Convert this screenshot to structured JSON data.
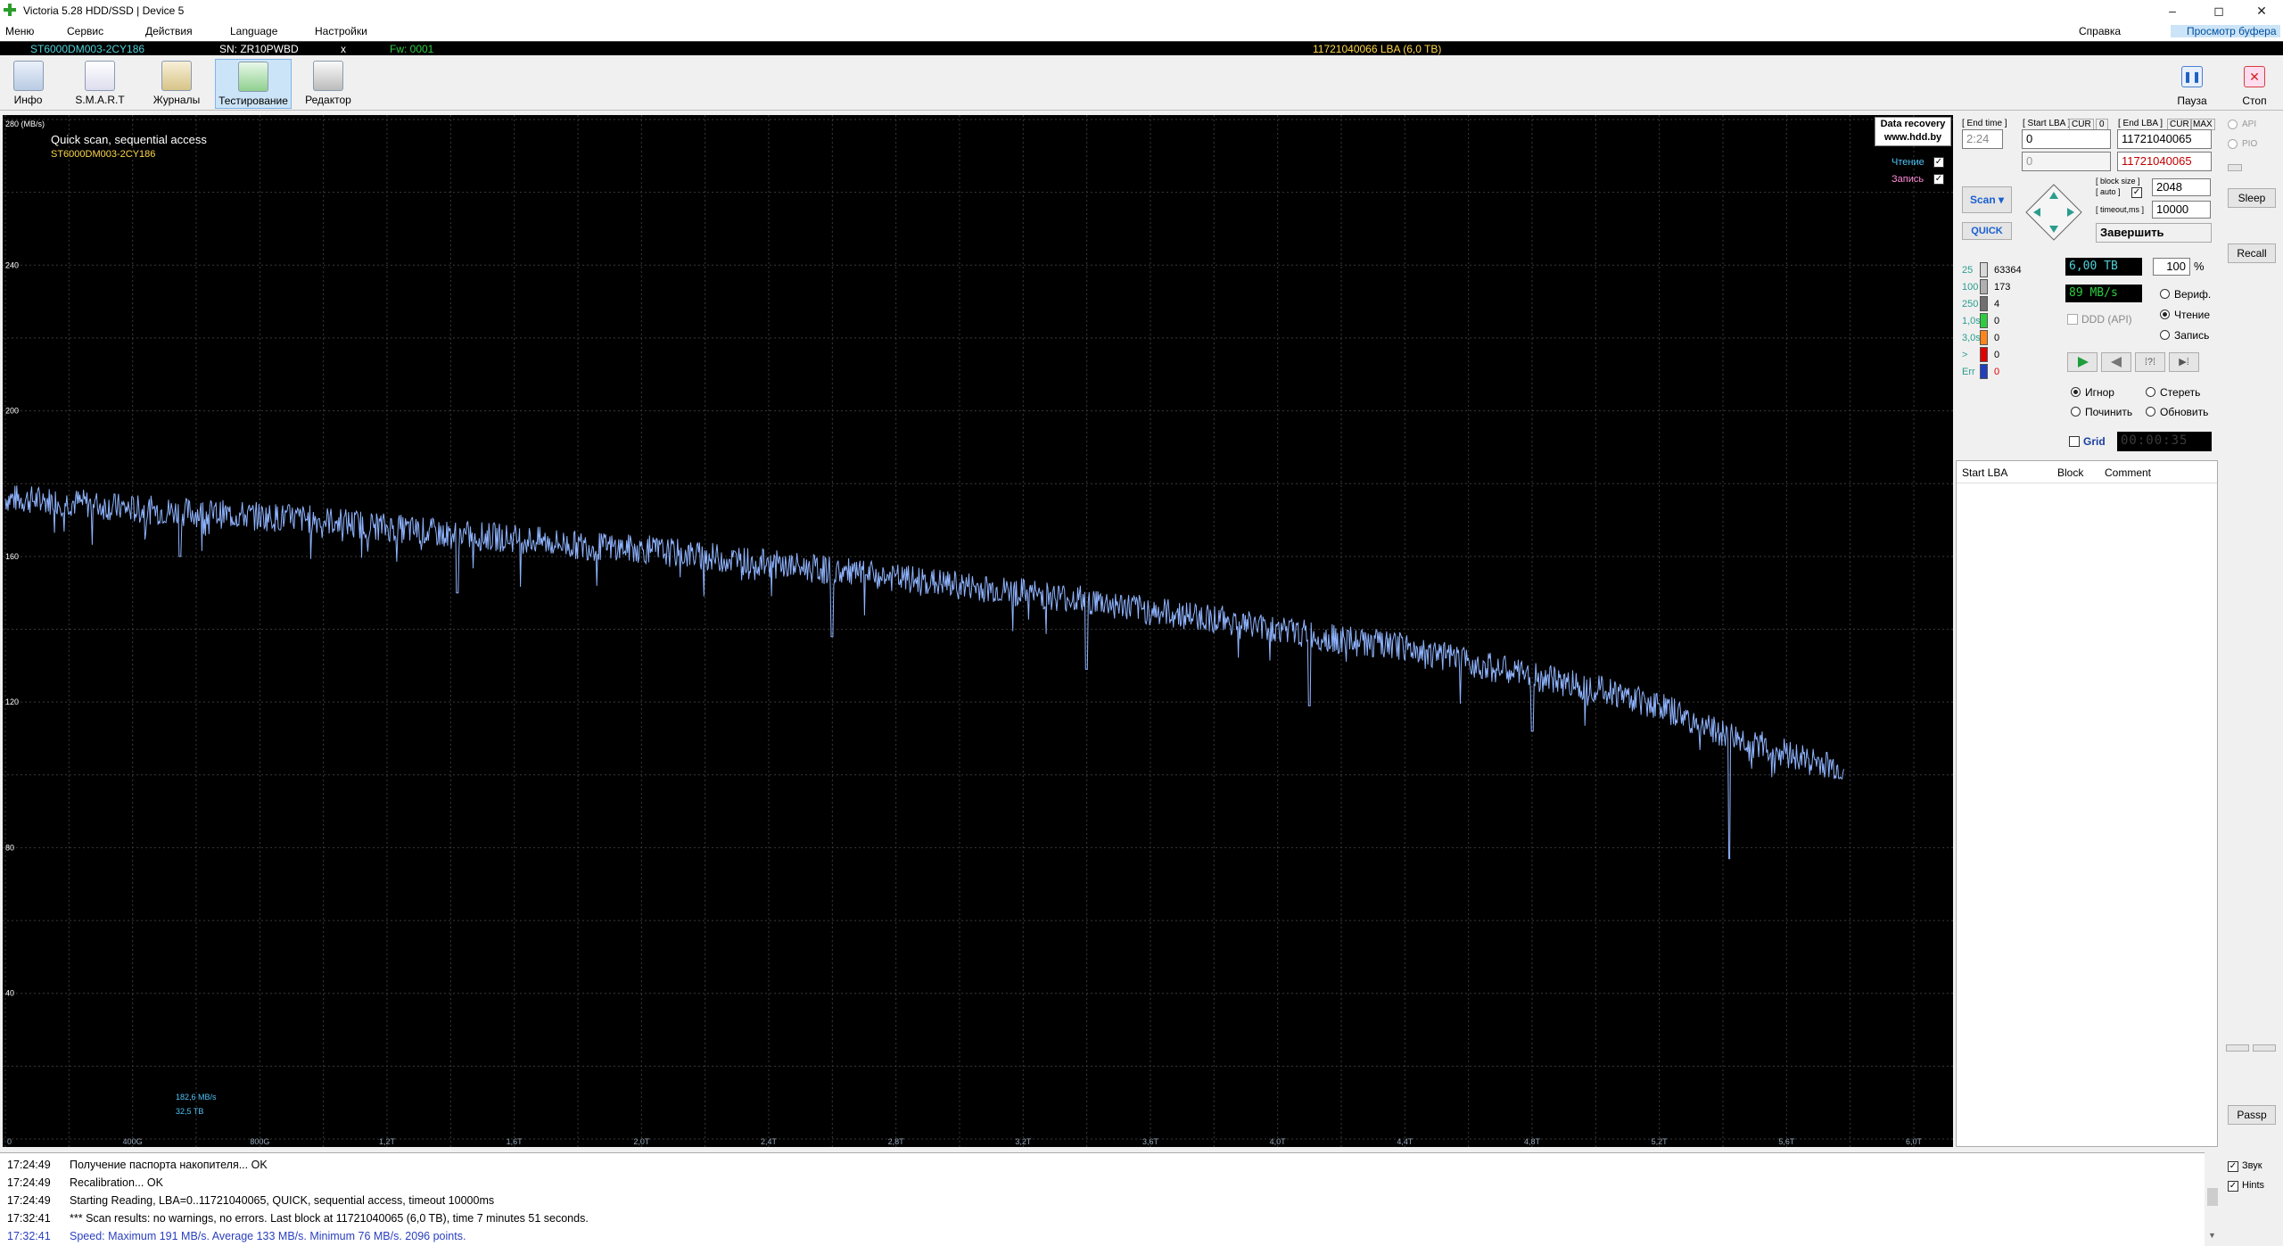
{
  "window": {
    "title": "Victoria 5.28 HDD/SSD | Device 5",
    "min": "–",
    "max": "◻",
    "close": "✕"
  },
  "menu": [
    "Меню",
    "Сервис",
    "Действия",
    "Language",
    "Настройки"
  ],
  "menu_right": {
    "help": "Справка",
    "clipboard": "Просмотр буфера"
  },
  "infobar": {
    "model": "ST6000DM003-2CY186",
    "sn": "SN: ZR10PWBD",
    "close": "x",
    "fw": "Fw: 0001",
    "capacity": "11721040066 LBA (6,0 TB)"
  },
  "toolbar": {
    "items": [
      "Инфо",
      "S.M.A.R.T",
      "Журналы",
      "Тестирование",
      "Редактор"
    ],
    "pause": "Пауза",
    "stop": "Стоп"
  },
  "plot": {
    "title": "Quick scan, sequential access",
    "model": "ST6000DM003-2CY186",
    "unit": "280 (MB/s)",
    "recovery1": "Data recovery",
    "recovery2": "www.hdd.by",
    "legend_read": "Чтение",
    "legend_write": "Запись",
    "cursor_speed": "182,6 MB/s",
    "cursor_pos": "32,5 TB"
  },
  "chart_data": {
    "type": "line",
    "ylim": [
      0,
      280
    ],
    "y_ticks": [
      "280 (MB/s)",
      "240",
      "200",
      "160",
      "120",
      "80",
      "40"
    ],
    "x_ticks": [
      "0",
      "400G",
      "800G",
      "1,2T",
      "1,6T",
      "2,0T",
      "2,4T",
      "2,8T",
      "3,2T",
      "3,6T",
      "4,0T",
      "4,4T",
      "4,8T",
      "5,2T",
      "5,6T",
      "6,0T"
    ],
    "x_unit": "TB",
    "xlim": [
      0,
      6.0
    ],
    "series": [
      {
        "points": [
          [
            0.0,
            176
          ],
          [
            0.2,
            175
          ],
          [
            0.4,
            173
          ],
          [
            0.6,
            172
          ],
          [
            0.8,
            171
          ],
          [
            1.0,
            170
          ],
          [
            1.2,
            168
          ],
          [
            1.4,
            166
          ],
          [
            1.6,
            165
          ],
          [
            1.8,
            163
          ],
          [
            2.0,
            162
          ],
          [
            2.2,
            160
          ],
          [
            2.4,
            158
          ],
          [
            2.6,
            156
          ],
          [
            2.8,
            154
          ],
          [
            3.0,
            152
          ],
          [
            3.2,
            150
          ],
          [
            3.4,
            148
          ],
          [
            3.6,
            145
          ],
          [
            3.8,
            143
          ],
          [
            4.0,
            140
          ],
          [
            4.2,
            137
          ],
          [
            4.4,
            135
          ],
          [
            4.6,
            131
          ],
          [
            4.8,
            127
          ],
          [
            5.0,
            124
          ],
          [
            5.2,
            119
          ],
          [
            5.4,
            111
          ],
          [
            5.6,
            106
          ],
          [
            5.78,
            101
          ]
        ],
        "dips": [
          [
            0.55,
            160
          ],
          [
            1.42,
            150
          ],
          [
            2.6,
            138
          ],
          [
            3.4,
            129
          ],
          [
            4.1,
            119
          ],
          [
            4.8,
            112
          ],
          [
            5.42,
            77
          ]
        ]
      }
    ],
    "grid": true
  },
  "right": {
    "end_time": "[ End time ]",
    "time_val": "2:24",
    "start_lba": "[ Start LBA ]",
    "cur": "CUR",
    "cur_val": "0",
    "end_lba": "[ End LBA ]",
    "cur2": "CUR",
    "max": "MAX",
    "start_val": "0",
    "start_val2": "0",
    "end_val": "11721040065",
    "end_val2": "11721040065",
    "scan": "Scan ▾",
    "quick": "QUICK",
    "block_size": "[ block size ]",
    "auto": "[ auto ]",
    "block_val": "2048",
    "timeout": "[ timeout,ms ]",
    "timeout_val": "10000",
    "finish": "Завершить",
    "stats": [
      {
        "label": "25",
        "color": "#d8d8d8",
        "count": "63364"
      },
      {
        "label": "100",
        "color": "#b0b0b0",
        "count": "173"
      },
      {
        "label": "250",
        "color": "#707070",
        "count": "4"
      },
      {
        "label": "1,0s",
        "color": "#2ecc40",
        "count": "0"
      },
      {
        "label": "3,0s",
        "color": "#ff851b",
        "count": "0"
      },
      {
        "label": ">",
        "color": "#e00000",
        "count": "0"
      },
      {
        "label": "Err",
        "color": "#1f3fbf",
        "count": "0"
      }
    ],
    "size": "6,00 TB",
    "percent": "100",
    "pct_sign": "%",
    "speed": "89 MB/s",
    "ddd": "DDD (API)",
    "verify": "Вериф.",
    "read": "Чтение",
    "write": "Запись",
    "ignore": "Игнор",
    "erase": "Стереть",
    "repair": "Починить",
    "refresh": "Обновить",
    "grid": "Grid",
    "timer": "00:00:35",
    "table_headers": [
      "Start LBA",
      "Block",
      "Comment"
    ]
  },
  "far": {
    "api": "API",
    "pio": "PIO",
    "sleep": "Sleep",
    "recall": "Recall",
    "passp": "Passp",
    "sound": "Звук",
    "hints": "Hints"
  },
  "log": [
    {
      "t": "17:24:49",
      "m": "Получение паспорта накопителя... OK",
      "c": "#000"
    },
    {
      "t": "17:24:49",
      "m": "Recalibration... OK",
      "c": "#000"
    },
    {
      "t": "17:24:49",
      "m": "Starting Reading, LBA=0..11721040065, QUICK, sequential access, timeout 10000ms",
      "c": "#000"
    },
    {
      "t": "17:32:41",
      "m": "*** Scan results: no warnings, no errors. Last block at 11721040065 (6,0 TB), time 7 minutes 51 seconds.",
      "c": "#000"
    },
    {
      "t": "17:32:41",
      "m": "Speed: Maximum 191 MB/s. Average 133 MB/s. Minimum 76 MB/s. 2096 points.",
      "c": "#2a3fbf"
    }
  ]
}
